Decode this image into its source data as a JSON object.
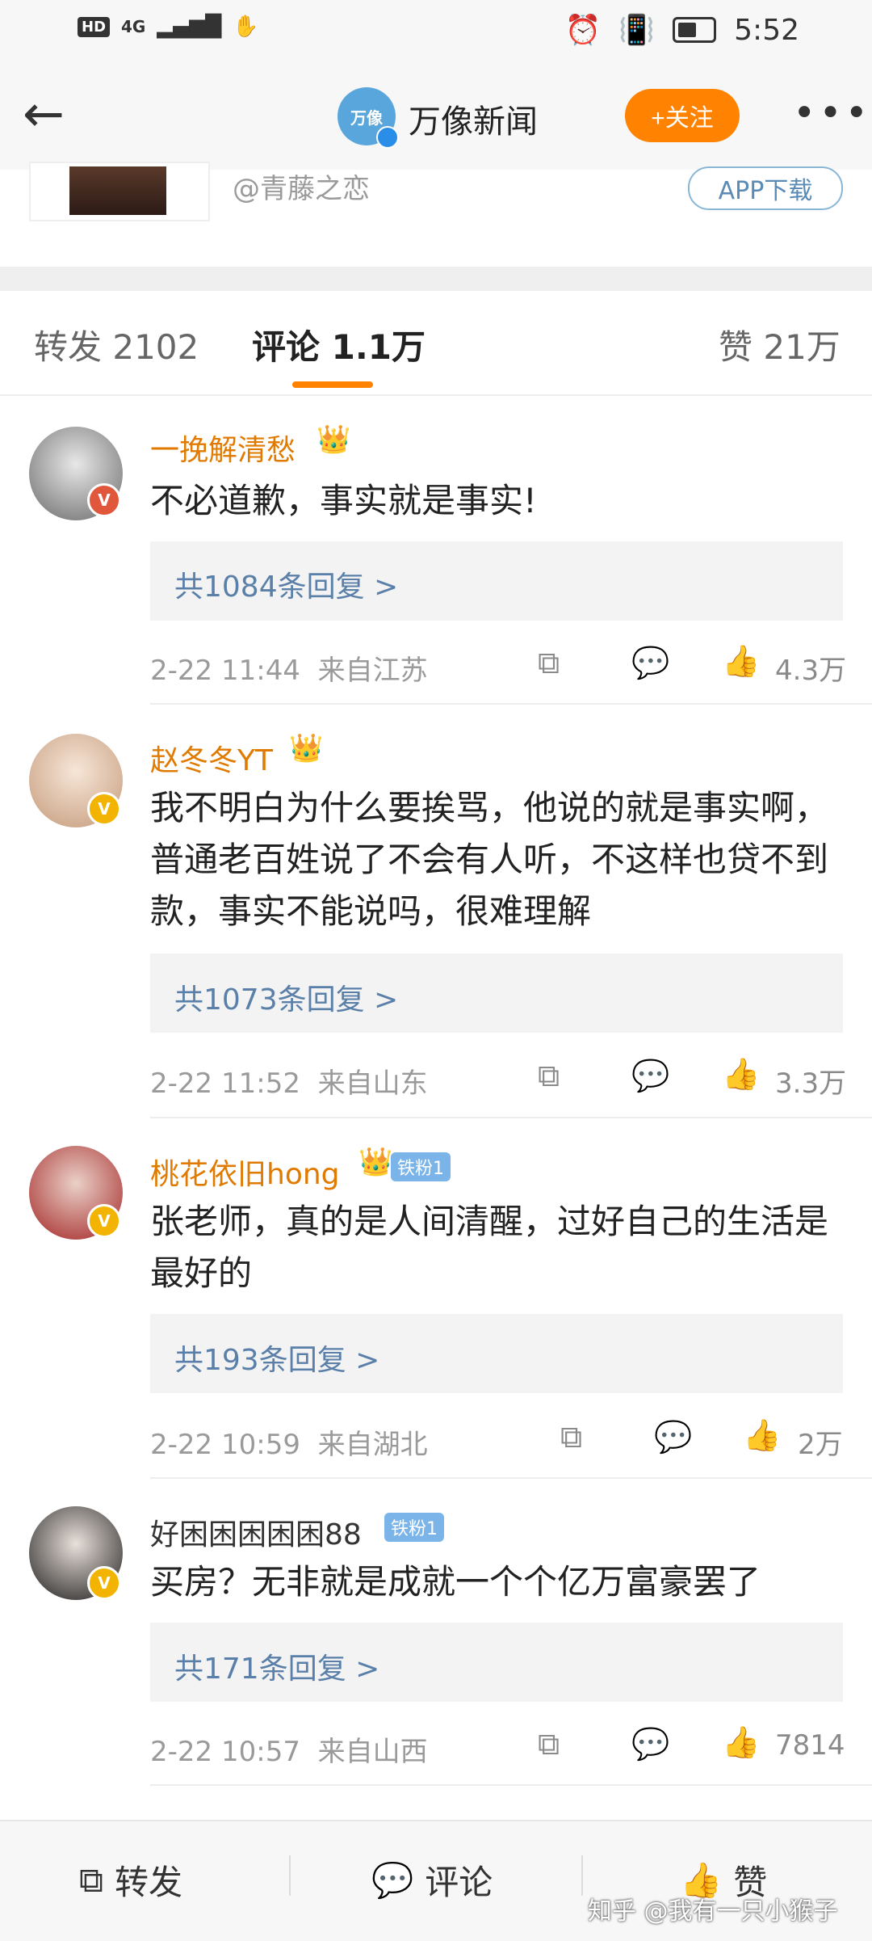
{
  "status_bar": {
    "hd": "HD",
    "network": "4G",
    "time": "5:52"
  },
  "header": {
    "back_icon": "arrow-left-icon",
    "logo_text": "万像",
    "title": "万像新闻",
    "follow_label": "+关注",
    "more_icon": "more-dots-icon"
  },
  "card": {
    "handle": "@青藤之恋",
    "app_download": "APP下载"
  },
  "tabs": {
    "repost": "转发 2102",
    "comment": "评论 1.1万",
    "like": "赞 21万"
  },
  "comments": [
    {
      "name": "一挽解清愁",
      "text": "不必道歉，事实就是事实!",
      "replies": "共1084条回复 >",
      "time": "2-22 11:44",
      "location": "来自江苏",
      "likes": "4.3万",
      "name_color": "#e07a00"
    },
    {
      "name": "赵冬冬YT",
      "text": "我不明白为什么要挨骂，他说的就是事实啊，普通老百姓说了不会有人听，不这样也贷不到款，事实不能说吗，很难理解",
      "replies": "共1073条回复 >",
      "time": "2-22 11:52",
      "location": "来自山东",
      "likes": "3.3万",
      "name_color": "#e07a00"
    },
    {
      "name": "桃花依旧hong",
      "fan_badge": "铁粉1",
      "text": "张老师，真的是人间清醒，过好自己的生活是最好的",
      "replies": "共193条回复 >",
      "time": "2-22 10:59",
      "location": "来自湖北",
      "likes": "2万",
      "name_color": "#e07a00"
    },
    {
      "name": "好困困困困困88",
      "fan_badge": "铁粉1",
      "text": "买房？无非就是成就一个个亿万富豪罢了",
      "replies": "共171条回复 >",
      "time": "2-22 10:57",
      "location": "来自山西",
      "likes": "7814",
      "name_color": "#333333"
    }
  ],
  "bottom_bar": {
    "repost": "转发",
    "comment": "评论",
    "like": "赞"
  },
  "watermark": "知乎 @我有一只小猴子",
  "colors": {
    "accent": "#ff8200",
    "link": "#5a7fa8"
  }
}
